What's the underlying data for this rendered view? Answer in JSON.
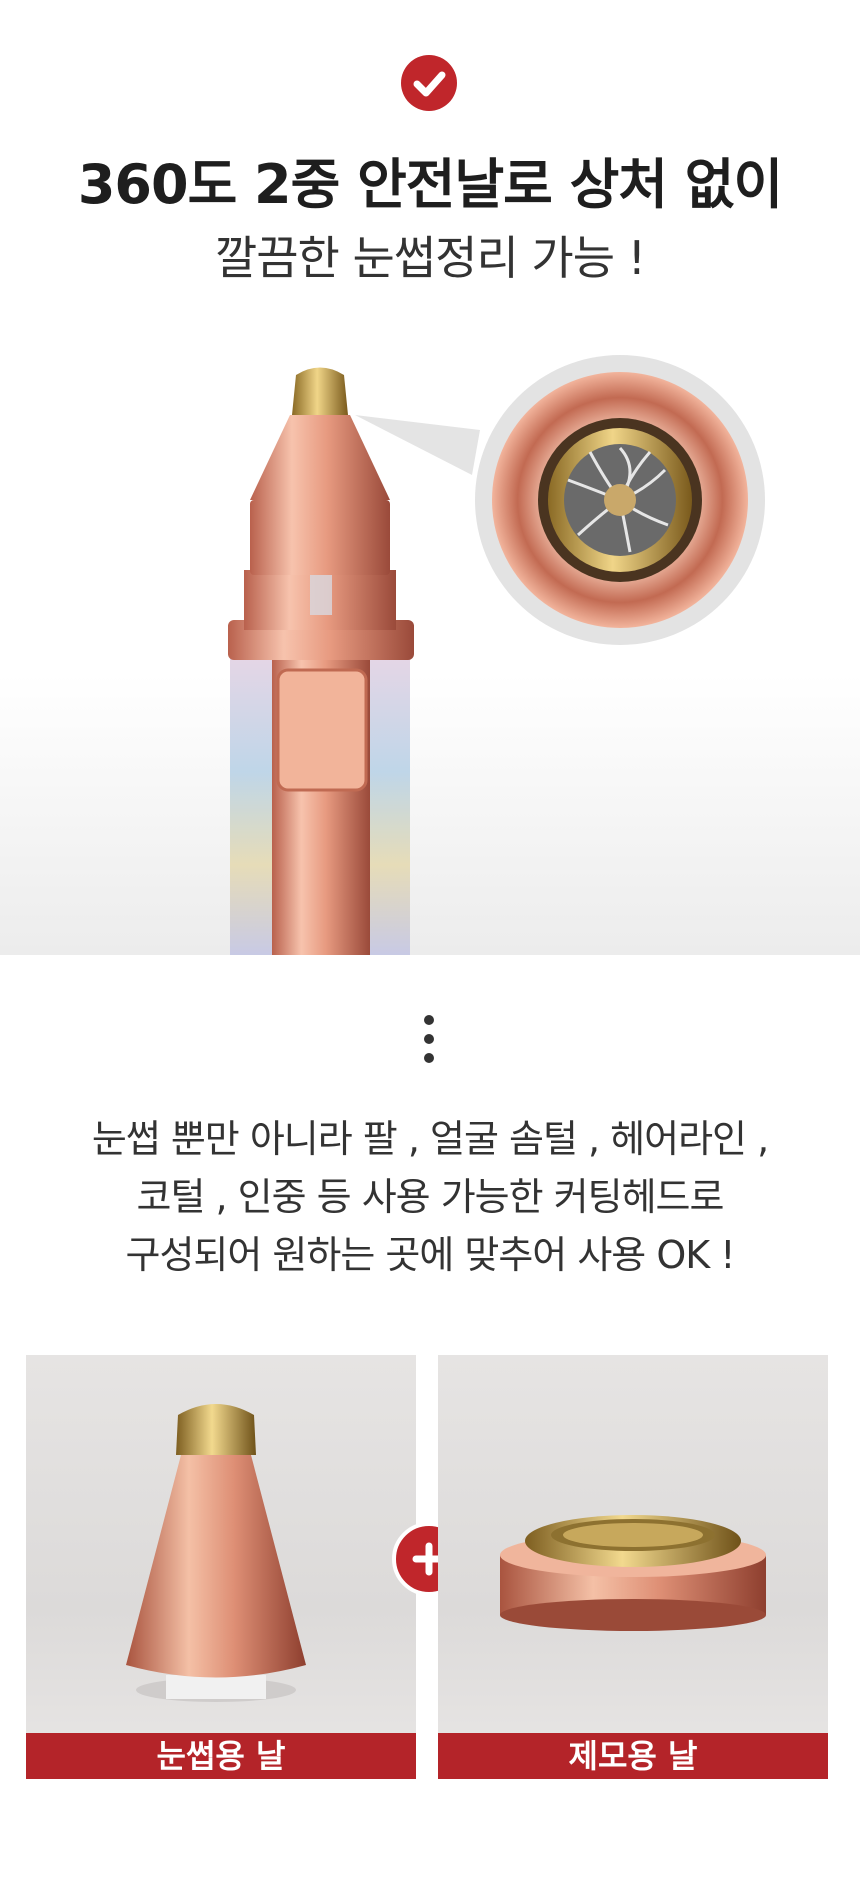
{
  "header": {
    "check_icon": "check-circle-icon",
    "accent_color": "#c0262b",
    "title_line1": "360도 2중 안전날로 상처 없이",
    "title_line2": "깔끔한 눈썹정리 가능 !"
  },
  "hero": {
    "product_image": "eyebrow-trimmer-product",
    "zoom_image": "blade-head-closeup"
  },
  "description": {
    "separator_icon": "vertical-dots-icon",
    "line1": "눈썹 뿐만 아니라 팔 , 얼굴 솜털 , 헤어라인 ,",
    "line2": "코털 , 인중 등 사용 가능한 커팅헤드로",
    "line3": "구성되어 원하는 곳에 맞추어 사용 OK !"
  },
  "heads": [
    {
      "label": "눈썹용 날",
      "image": "eyebrow-blade-head"
    },
    {
      "label": "제모용 날",
      "image": "hair-removal-blade-head"
    }
  ],
  "plus_icon": "plus-icon",
  "caption_color": "#b42429"
}
